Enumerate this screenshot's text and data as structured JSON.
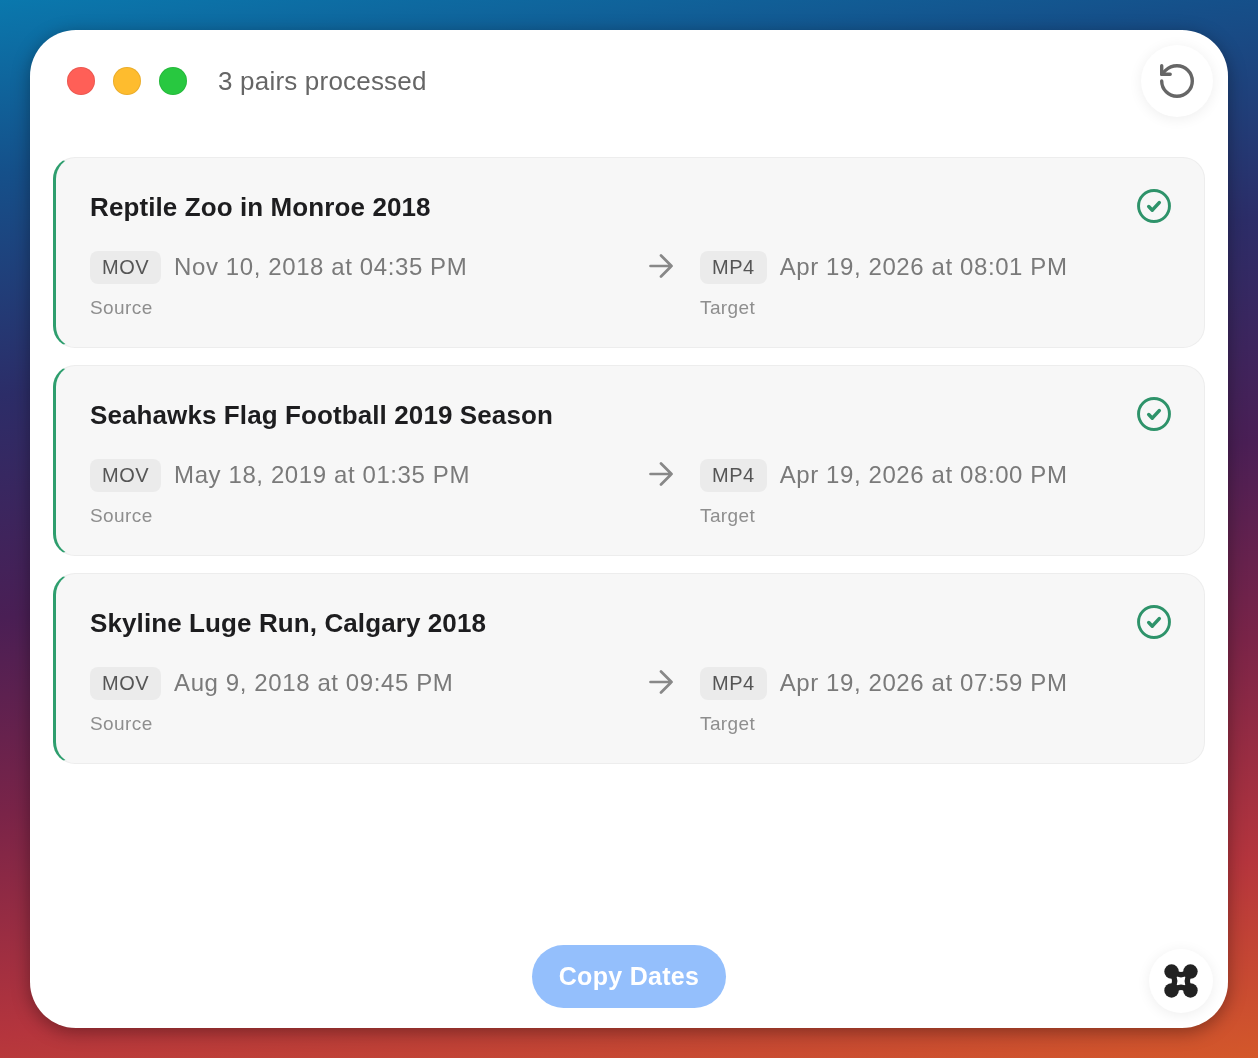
{
  "window": {
    "title": "3 pairs processed",
    "controls": [
      {
        "color": "#ff5f57"
      },
      {
        "color": "#febc2e"
      },
      {
        "color": "#28c840"
      }
    ]
  },
  "pairs": [
    {
      "title": "Reptile Zoo in Monroe 2018",
      "completed": true,
      "source": {
        "format": "MOV",
        "date": "Nov 10, 2018 at 04:35 PM",
        "label": "Source"
      },
      "target": {
        "format": "MP4",
        "date": "Apr 19, 2026 at 08:01 PM",
        "label": "Target"
      }
    },
    {
      "title": "Seahawks Flag Football 2019 Season",
      "completed": true,
      "source": {
        "format": "MOV",
        "date": "May 18, 2019 at 01:35 PM",
        "label": "Source"
      },
      "target": {
        "format": "MP4",
        "date": "Apr 19, 2026 at 08:00 PM",
        "label": "Target"
      }
    },
    {
      "title": "Skyline Luge Run, Calgary 2018",
      "completed": true,
      "source": {
        "format": "MOV",
        "date": "Aug 9, 2018 at 09:45 PM",
        "label": "Source"
      },
      "target": {
        "format": "MP4",
        "date": "Apr 19, 2026 at 07:59 PM",
        "label": "Target"
      }
    }
  ],
  "footer": {
    "button": {
      "label": "Copy Dates",
      "disabled": true
    }
  }
}
